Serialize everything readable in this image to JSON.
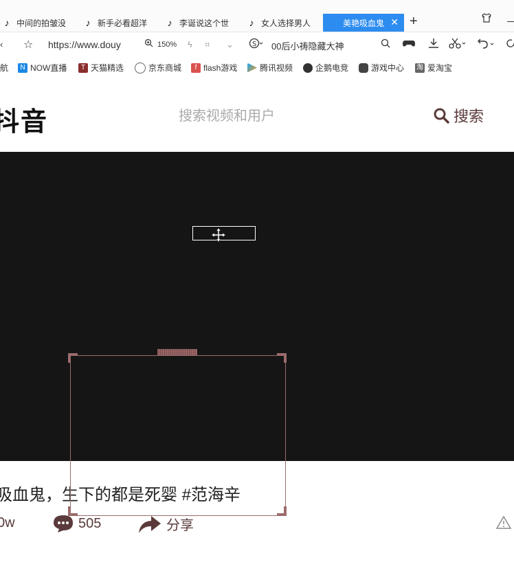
{
  "browser": {
    "tabs": [
      {
        "label": "中间的拍皱没"
      },
      {
        "label": "新手必看超洋"
      },
      {
        "label": "李诞说这个世"
      },
      {
        "label": "女人选择男人"
      },
      {
        "label": "美艳吸血鬼",
        "active": true
      }
    ],
    "address": {
      "url": "https://www.douy",
      "zoom": "150%",
      "hot_search": "00后小祷隐藏大神"
    },
    "bookmarks": [
      {
        "label": "航"
      },
      {
        "label": "NOW直播"
      },
      {
        "label": "天猫精选"
      },
      {
        "label": "京东商城"
      },
      {
        "label": "flash游戏"
      },
      {
        "label": "腾讯视频"
      },
      {
        "label": "企鹅电竞"
      },
      {
        "label": "游戏中心"
      },
      {
        "label": "爱淘宝"
      }
    ]
  },
  "page": {
    "logo": "抖音",
    "search": {
      "placeholder": "搜索视频和用户",
      "button_label": "搜索"
    },
    "caption": "吸血鬼，生下的都是死婴 #范海辛",
    "actions": {
      "likes": "0w",
      "comments": "505",
      "share_label": "分享"
    }
  },
  "colors": {
    "accent_tab": "#2d8cf0",
    "video_bg": "#151515",
    "selection_border": "#9b6b6b",
    "icon_brown": "#5a3a3a"
  }
}
